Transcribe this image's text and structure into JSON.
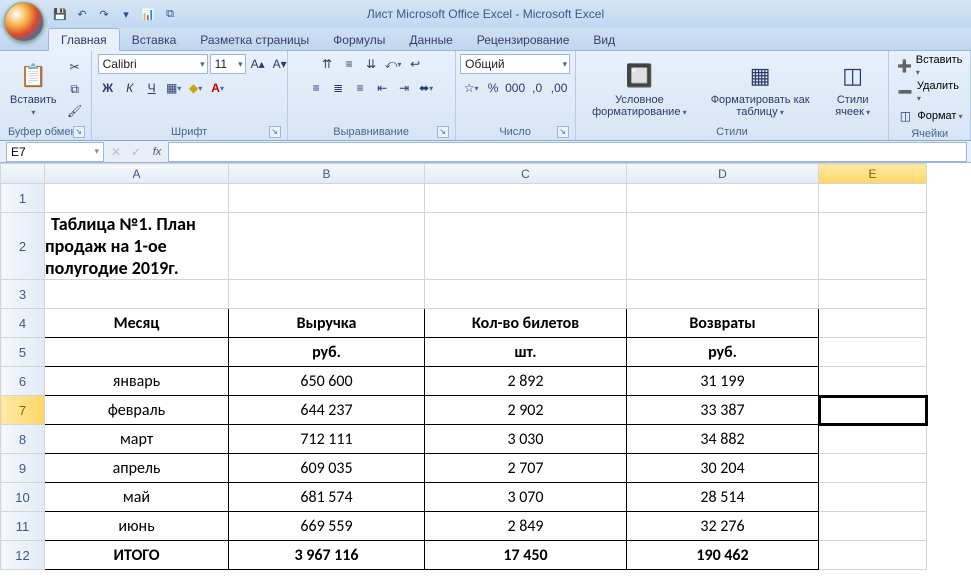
{
  "app": {
    "title": "Лист Microsoft Office Excel - Microsoft Excel"
  },
  "tabs": {
    "home": "Главная",
    "insert": "Вставка",
    "layout": "Разметка страницы",
    "formulas": "Формулы",
    "data": "Данные",
    "review": "Рецензирование",
    "view": "Вид"
  },
  "ribbon": {
    "clipboard": {
      "paste": "Вставить",
      "label": "Буфер обмена"
    },
    "font": {
      "name": "Calibri",
      "size": "11",
      "label": "Шрифт"
    },
    "align": {
      "label": "Выравнивание"
    },
    "number": {
      "format": "Общий",
      "label": "Число"
    },
    "styles": {
      "cond": "Условное форматирование",
      "table": "Форматировать как таблицу",
      "cell": "Стили ячеек",
      "label": "Стили"
    },
    "cells": {
      "insert": "Вставить",
      "delete": "Удалить",
      "format": "Формат",
      "label": "Ячейки"
    }
  },
  "formula_bar": {
    "name_box": "E7",
    "formula": ""
  },
  "columns": [
    "A",
    "B",
    "C",
    "D",
    "E"
  ],
  "active": {
    "row": 7,
    "col": "E"
  },
  "sheet": {
    "title": "Таблица №1. План продаж на 1-ое полугодие 2019г.",
    "headers": {
      "month": "Месяц",
      "revenue": "Выручка",
      "revenue_unit": "руб.",
      "tickets": "Кол-во билетов",
      "tickets_unit": "шт.",
      "returns": "Возвраты",
      "returns_unit": "руб."
    },
    "rows": [
      {
        "m": "январь",
        "r": "650 600",
        "t": "2 892",
        "v": "31 199"
      },
      {
        "m": "февраль",
        "r": "644 237",
        "t": "2 902",
        "v": "33 387"
      },
      {
        "m": "март",
        "r": "712 111",
        "t": "3 030",
        "v": "34 882"
      },
      {
        "m": "апрель",
        "r": "609 035",
        "t": "2 707",
        "v": "30 204"
      },
      {
        "m": "май",
        "r": "681 574",
        "t": "3 070",
        "v": "28 514"
      },
      {
        "m": "июнь",
        "r": "669 559",
        "t": "2 849",
        "v": "32 276"
      }
    ],
    "total": {
      "m": "ИТОГО",
      "r": "3 967 116",
      "t": "17 450",
      "v": "190 462"
    }
  }
}
